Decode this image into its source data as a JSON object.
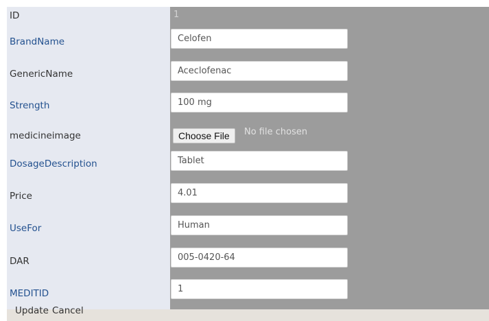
{
  "form": {
    "id": {
      "label": "ID",
      "value": "1"
    },
    "brand_name": {
      "label": "BrandName",
      "value": "Celofen"
    },
    "generic_name": {
      "label": "GenericName",
      "value": "Aceclofenac"
    },
    "strength": {
      "label": "Strength",
      "value": "100 mg"
    },
    "medicine_image": {
      "label": "medicineimage",
      "button_label": "Choose File",
      "status": "No file chosen"
    },
    "dosage_description": {
      "label": "DosageDescription",
      "value": "Tablet"
    },
    "price": {
      "label": "Price",
      "value": "4.01"
    },
    "use_for": {
      "label": "UseFor",
      "value": "Human"
    },
    "dar": {
      "label": "DAR",
      "value": "005-0420-64"
    },
    "meditid": {
      "label": "MEDITID",
      "value": "1"
    }
  },
  "actions": {
    "update_label": "Update",
    "cancel_label": "Cancel"
  },
  "colors": {
    "label_column_bg": "#e6e9f1",
    "value_column_bg": "#9c9c9c",
    "footer_bg": "#e6e2dc",
    "label_dark": "#333333",
    "label_link": "#23518f"
  }
}
